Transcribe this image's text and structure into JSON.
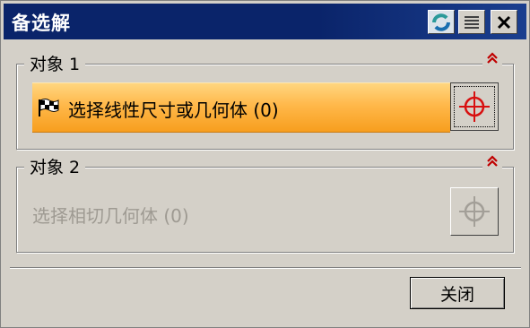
{
  "window": {
    "title": "备选解"
  },
  "titlebar_buttons": [
    {
      "icon": "refresh-icon"
    },
    {
      "icon": "menu-icon"
    },
    {
      "icon": "close-icon"
    }
  ],
  "groups": [
    {
      "label": "对象 1",
      "collapse_icon": "double-chevron-up-icon",
      "selector": {
        "text": "选择线性尺寸或几何体  (0)",
        "state": "active",
        "icon": "checkered-flag-icon"
      },
      "target_icon": "crosshair-icon"
    },
    {
      "label": "对象 2",
      "collapse_icon": "double-chevron-up-icon",
      "selector": {
        "text": "选择相切几何体  (0)",
        "state": "inactive"
      },
      "target_icon": "crosshair-icon"
    }
  ],
  "footer": {
    "close_label": "关闭"
  },
  "colors": {
    "titlebar": "#0a246a",
    "active_selector": "#f79e1e",
    "crosshair_active": "#d81010",
    "collapse_chevron": "#c00000"
  }
}
